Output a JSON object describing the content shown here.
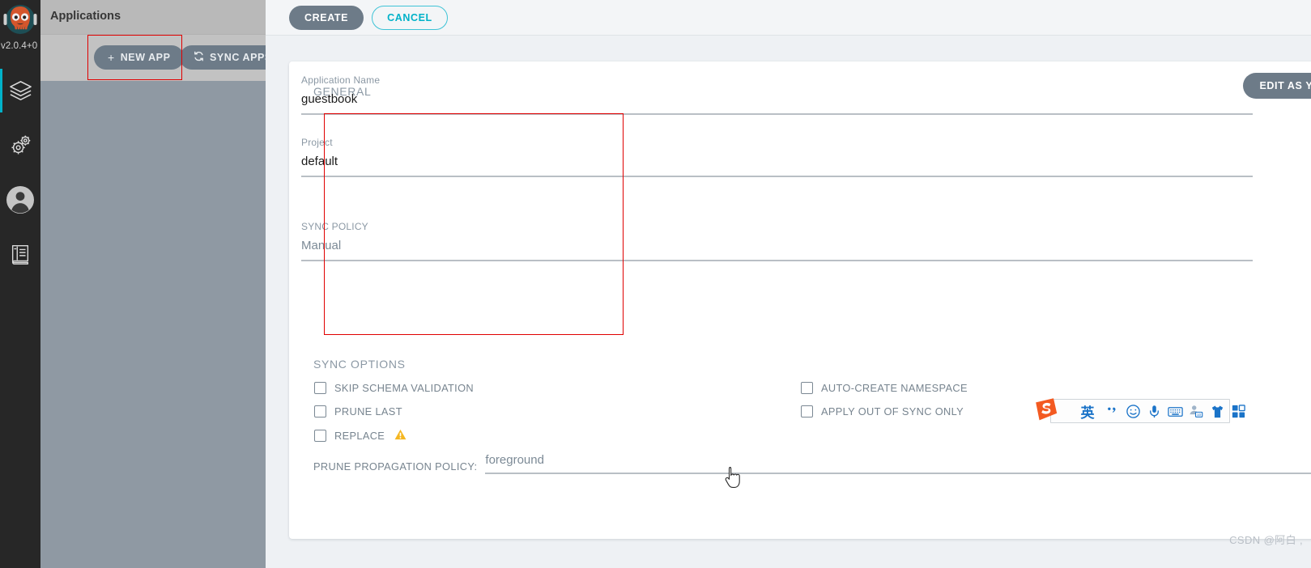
{
  "rail": {
    "version": "v2.0.4+0",
    "items": [
      {
        "name": "applications",
        "icon": "layers-icon",
        "active": true
      },
      {
        "name": "settings",
        "icon": "gears-icon",
        "active": false
      },
      {
        "name": "user-info",
        "icon": "user-avatar-icon",
        "active": false
      },
      {
        "name": "documentation",
        "icon": "book-icon",
        "active": false
      }
    ]
  },
  "apps_pane": {
    "title": "Applications",
    "new_app_label": "NEW APP",
    "new_app_glyph": "+",
    "sync_apps_label": "SYNC APPS",
    "sync_apps_glyph": "refresh-icon"
  },
  "topbar": {
    "create_label": "CREATE",
    "cancel_label": "CANCEL"
  },
  "form": {
    "edit_as_yaml_label": "EDIT AS YAML",
    "general_title": "GENERAL",
    "sync_options_title": "SYNC OPTIONS",
    "fields": [
      {
        "label": "Application Name",
        "value": "guestbook",
        "muted": false
      },
      {
        "label": "Project",
        "value": "default",
        "muted": false
      },
      {
        "label": "SYNC POLICY",
        "value": "Manual",
        "muted": true
      }
    ],
    "checkboxes_left": [
      {
        "label": "SKIP SCHEMA VALIDATION",
        "checked": false,
        "warning": ""
      },
      {
        "label": "PRUNE LAST",
        "checked": false,
        "warning": ""
      },
      {
        "label": "REPLACE",
        "checked": false,
        "warning": "⚠"
      }
    ],
    "checkboxes_right": [
      {
        "label": "AUTO-CREATE NAMESPACE",
        "checked": false
      },
      {
        "label": "APPLY OUT OF SYNC ONLY",
        "checked": false
      }
    ],
    "prune_policy_label": "PRUNE PROPAGATION POLICY:",
    "prune_policy_value": "foreground"
  },
  "ime": {
    "logo": "sogou-logo-icon",
    "mode_label": "英",
    "items": [
      "punctuation-icon",
      "emoji-icon",
      "microphone-icon",
      "keyboard-icon",
      "account-icon",
      "skin-icon",
      "menu-grid-icon"
    ]
  },
  "watermark": "CSDN @阿白 ,",
  "colors": {
    "accent": "#00b2c9",
    "button": "#6d7b88",
    "highlight": "#e00000",
    "ime_blue": "#1a73c8"
  }
}
